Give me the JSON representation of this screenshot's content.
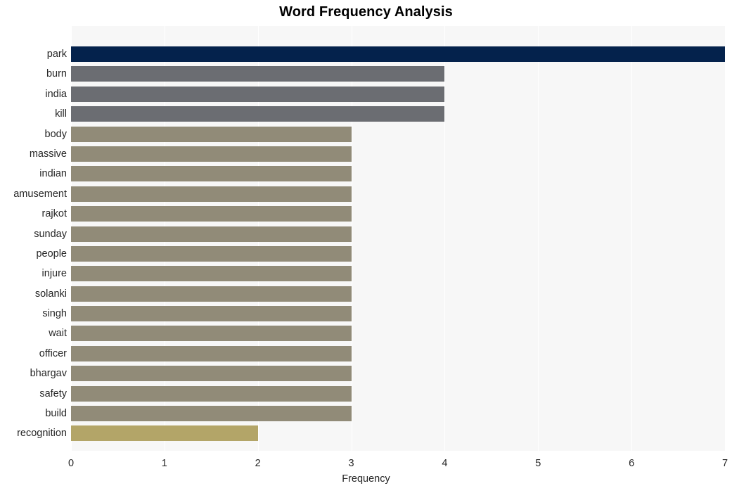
{
  "chart_data": {
    "type": "bar",
    "orientation": "horizontal",
    "title": "Word Frequency Analysis",
    "xlabel": "Frequency",
    "ylabel": "",
    "xlim": [
      0,
      7
    ],
    "xticks": [
      0,
      1,
      2,
      3,
      4,
      5,
      6,
      7
    ],
    "xtick_labels": [
      "0",
      "1",
      "2",
      "3",
      "4",
      "5",
      "6",
      "7"
    ],
    "grid": true,
    "grid_axis": "x",
    "grid_color": "#ffffff",
    "plot_background": "#f7f7f7",
    "figure_background": "#ffffff",
    "legend": null,
    "categories": [
      "park",
      "burn",
      "india",
      "kill",
      "body",
      "massive",
      "indian",
      "amusement",
      "rajkot",
      "sunday",
      "people",
      "injure",
      "solanki",
      "singh",
      "wait",
      "officer",
      "bhargav",
      "safety",
      "build",
      "recognition"
    ],
    "values": [
      7,
      4,
      4,
      4,
      3,
      3,
      3,
      3,
      3,
      3,
      3,
      3,
      3,
      3,
      3,
      3,
      3,
      3,
      3,
      2
    ],
    "bar_colors": [
      "#04224c",
      "#6b6d72",
      "#6b6d72",
      "#6b6d72",
      "#918b78",
      "#918b78",
      "#918b78",
      "#918b78",
      "#918b78",
      "#918b78",
      "#918b78",
      "#918b78",
      "#918b78",
      "#918b78",
      "#918b78",
      "#918b78",
      "#918b78",
      "#918b78",
      "#918b78",
      "#b3a568"
    ]
  }
}
